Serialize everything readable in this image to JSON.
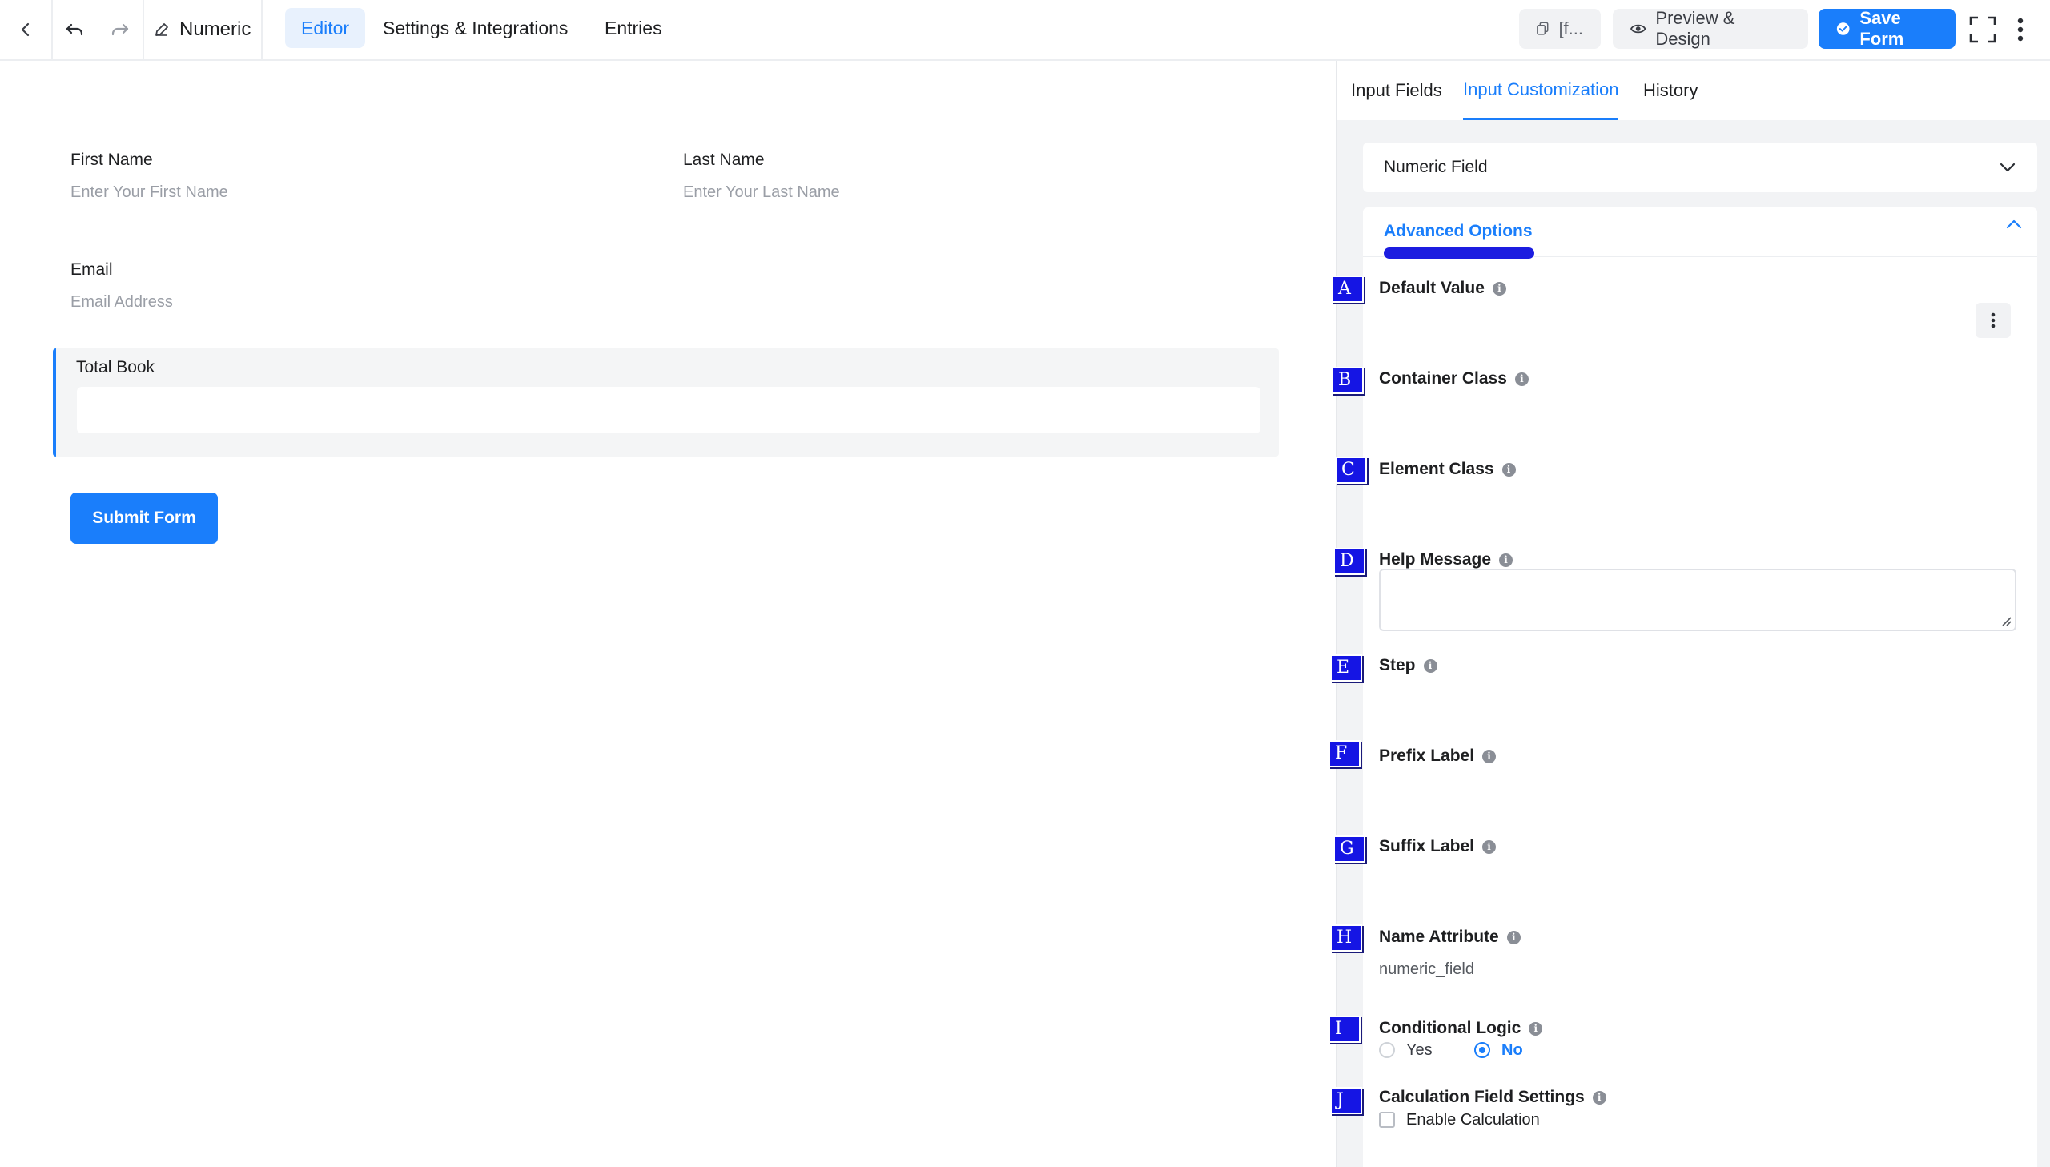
{
  "topbar": {
    "title": "Numeric",
    "tabs": [
      {
        "label": "Editor",
        "active": true
      },
      {
        "label": "Settings & Integrations",
        "active": false
      },
      {
        "label": "Entries",
        "active": false
      }
    ],
    "shortcode_label": "[f...",
    "preview_label": "Preview & Design",
    "save_label": "Save Form"
  },
  "form": {
    "fields": [
      {
        "label": "First Name",
        "placeholder": "Enter Your First Name"
      },
      {
        "label": "Last Name",
        "placeholder": "Enter Your Last Name"
      },
      {
        "label": "Email",
        "placeholder": "Email Address"
      },
      {
        "label": "Total Book",
        "placeholder": ""
      }
    ],
    "submit_label": "Submit Form"
  },
  "panel": {
    "tabs": [
      {
        "label": "Input Fields",
        "active": false
      },
      {
        "label": "Input Customization",
        "active": true
      },
      {
        "label": "History",
        "active": false
      }
    ],
    "field_type": "Numeric Field",
    "advanced_title": "Advanced Options",
    "options": [
      {
        "marker": "A",
        "label": "Default Value"
      },
      {
        "marker": "B",
        "label": "Container Class"
      },
      {
        "marker": "C",
        "label": "Element Class"
      },
      {
        "marker": "D",
        "label": "Help Message"
      },
      {
        "marker": "E",
        "label": "Step"
      },
      {
        "marker": "F",
        "label": "Prefix Label"
      },
      {
        "marker": "G",
        "label": "Suffix Label"
      },
      {
        "marker": "H",
        "label": "Name Attribute"
      },
      {
        "marker": "I",
        "label": "Conditional Logic"
      },
      {
        "marker": "J",
        "label": "Calculation Field Settings"
      }
    ],
    "name_attribute_value": "numeric_field",
    "conditional": {
      "yes": "Yes",
      "no": "No",
      "selected": "No"
    },
    "calculation": {
      "checkbox_label": "Enable Calculation",
      "checked": false
    }
  },
  "colors": {
    "accent": "#1a7efb",
    "marker": "#1515e4"
  }
}
